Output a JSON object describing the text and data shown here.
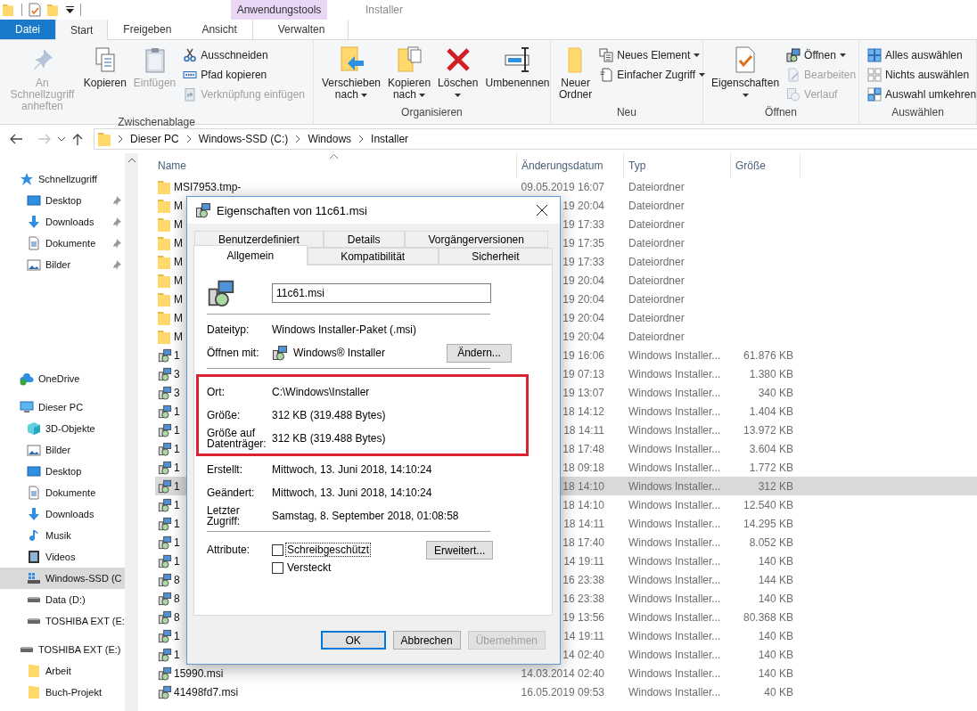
{
  "title_bar": {
    "context_label": "Anwendungstools",
    "window_title": "Installer"
  },
  "ribbon_tabs": [
    {
      "label": "Datei",
      "kind": "file",
      "selected": false
    },
    {
      "label": "Start",
      "kind": "tab",
      "selected": true
    },
    {
      "label": "Freigeben",
      "kind": "tab",
      "selected": false
    },
    {
      "label": "Ansicht",
      "kind": "tab",
      "selected": false
    },
    {
      "label": "Verwalten",
      "kind": "contextual",
      "selected": false
    }
  ],
  "ribbon_groups": [
    {
      "label": "Zwischenablage",
      "items": [
        {
          "label": "An Schnellzugriff anheften",
          "kind": "large",
          "disabled": true,
          "dropdown": false
        },
        {
          "label": "Kopieren",
          "kind": "large",
          "disabled": false,
          "dropdown": false
        },
        {
          "label": "Einfügen",
          "kind": "large",
          "disabled": true,
          "dropdown": false
        },
        {
          "label": "Ausschneiden",
          "kind": "small",
          "disabled": false,
          "dropdown": false
        },
        {
          "label": "Pfad kopieren",
          "kind": "small",
          "disabled": false,
          "dropdown": false
        },
        {
          "label": "Verknüpfung einfügen",
          "kind": "small",
          "disabled": true,
          "dropdown": false
        }
      ]
    },
    {
      "label": "Organisieren",
      "items": [
        {
          "label": "Verschieben nach",
          "kind": "large",
          "disabled": false,
          "dropdown": true
        },
        {
          "label": "Kopieren nach",
          "kind": "large",
          "disabled": false,
          "dropdown": true
        },
        {
          "label": "Löschen",
          "kind": "large",
          "disabled": false,
          "dropdown": true
        },
        {
          "label": "Umbenennen",
          "kind": "large",
          "disabled": false,
          "dropdown": false
        }
      ]
    },
    {
      "label": "Neu",
      "items": [
        {
          "label": "Neuer Ordner",
          "kind": "large",
          "disabled": false,
          "dropdown": false
        },
        {
          "label": "Neues Element",
          "kind": "small",
          "disabled": false,
          "dropdown": true
        },
        {
          "label": "Einfacher Zugriff",
          "kind": "small",
          "disabled": false,
          "dropdown": true
        }
      ]
    },
    {
      "label": "Öffnen",
      "items": [
        {
          "label": "Eigenschaften",
          "kind": "large",
          "disabled": false,
          "dropdown": true
        },
        {
          "label": "Öffnen",
          "kind": "small",
          "disabled": false,
          "dropdown": true
        },
        {
          "label": "Bearbeiten",
          "kind": "small",
          "disabled": true,
          "dropdown": false
        },
        {
          "label": "Verlauf",
          "kind": "small",
          "disabled": true,
          "dropdown": false
        }
      ]
    },
    {
      "label": "Auswählen",
      "items": [
        {
          "label": "Alles auswählen",
          "kind": "small",
          "disabled": false,
          "dropdown": false
        },
        {
          "label": "Nichts auswählen",
          "kind": "small",
          "disabled": false,
          "dropdown": false
        },
        {
          "label": "Auswahl umkehren",
          "kind": "small",
          "disabled": false,
          "dropdown": false
        }
      ]
    }
  ],
  "address_bar": {
    "forward_disabled": true,
    "path": [
      "Dieser PC",
      "Windows-SSD (C:)",
      "Windows",
      "Installer"
    ]
  },
  "sidebar": {
    "sections": [
      {
        "label": "Schnellzugriff",
        "kind": "quick",
        "selected": false,
        "children": [
          {
            "label": "Desktop",
            "kind": "desktop",
            "pinned": true,
            "selected": false
          },
          {
            "label": "Downloads",
            "kind": "downloads",
            "pinned": true,
            "selected": false
          },
          {
            "label": "Dokumente",
            "kind": "documents",
            "pinned": true,
            "selected": false
          },
          {
            "label": "Bilder",
            "kind": "pictures",
            "pinned": true,
            "selected": false
          }
        ]
      },
      {
        "label": "OneDrive",
        "kind": "cloud",
        "selected": false
      },
      {
        "label": "Dieser PC",
        "kind": "pc",
        "selected": false,
        "children": [
          {
            "label": "3D-Objekte",
            "kind": "cube",
            "selected": false
          },
          {
            "label": "Bilder",
            "kind": "pictures",
            "selected": false
          },
          {
            "label": "Desktop",
            "kind": "desktop",
            "selected": false
          },
          {
            "label": "Dokumente",
            "kind": "documents",
            "selected": false
          },
          {
            "label": "Downloads",
            "kind": "downloads",
            "selected": false
          },
          {
            "label": "Musik",
            "kind": "music",
            "selected": false
          },
          {
            "label": "Videos",
            "kind": "videos",
            "selected": false
          },
          {
            "label": "Windows-SSD (C",
            "kind": "system-drive",
            "selected": true
          },
          {
            "label": "Data (D:)",
            "kind": "drive",
            "selected": false
          },
          {
            "label": "TOSHIBA EXT (E:",
            "kind": "drive",
            "selected": false
          }
        ]
      },
      {
        "label": "TOSHIBA EXT (E:)",
        "kind": "drive",
        "selected": false,
        "children": [
          {
            "label": "Arbeit",
            "kind": "folder",
            "selected": false
          },
          {
            "label": "Buch-Projekt",
            "kind": "folder",
            "selected": false
          }
        ]
      }
    ]
  },
  "file_list": {
    "columns": [
      "Name",
      "Änderungsdatum",
      "Typ",
      "Größe"
    ],
    "rows": [
      {
        "name": "MSI7953.tmp-",
        "date": "09.05.2019 16:07",
        "type": "Dateiordner",
        "size": "",
        "kind": "folder",
        "selected": false
      },
      {
        "name": "M",
        "date": "19 20:04",
        "type": "Dateiordner",
        "size": "",
        "kind": "folder",
        "selected": false
      },
      {
        "name": "M",
        "date": "19 17:33",
        "type": "Dateiordner",
        "size": "",
        "kind": "folder",
        "selected": false
      },
      {
        "name": "M",
        "date": "19 17:35",
        "type": "Dateiordner",
        "size": "",
        "kind": "folder",
        "selected": false
      },
      {
        "name": "M",
        "date": "19 17:33",
        "type": "Dateiordner",
        "size": "",
        "kind": "folder",
        "selected": false
      },
      {
        "name": "M",
        "date": "19 20:04",
        "type": "Dateiordner",
        "size": "",
        "kind": "folder",
        "selected": false
      },
      {
        "name": "M",
        "date": "19 20:04",
        "type": "Dateiordner",
        "size": "",
        "kind": "folder",
        "selected": false
      },
      {
        "name": "M",
        "date": "19 20:04",
        "type": "Dateiordner",
        "size": "",
        "kind": "folder",
        "selected": false
      },
      {
        "name": "M",
        "date": "19 20:04",
        "type": "Dateiordner",
        "size": "",
        "kind": "folder",
        "selected": false
      },
      {
        "name": "1",
        "date": "19 16:06",
        "type": "Windows Installer...",
        "size": "61.876 KB",
        "kind": "installer",
        "selected": false
      },
      {
        "name": "3",
        "date": "19 07:13",
        "type": "Windows Installer...",
        "size": "1.380 KB",
        "kind": "installer",
        "selected": false
      },
      {
        "name": "3",
        "date": "19 13:07",
        "type": "Windows Installer...",
        "size": "340 KB",
        "kind": "installer",
        "selected": false
      },
      {
        "name": "1",
        "date": "18 14:12",
        "type": "Windows Installer...",
        "size": "1.404 KB",
        "kind": "installer",
        "selected": false
      },
      {
        "name": "1",
        "date": "18 14:11",
        "type": "Windows Installer...",
        "size": "13.972 KB",
        "kind": "installer",
        "selected": false
      },
      {
        "name": "1",
        "date": "18 17:48",
        "type": "Windows Installer...",
        "size": "3.604 KB",
        "kind": "installer",
        "selected": false
      },
      {
        "name": "1",
        "date": "18 09:18",
        "type": "Windows Installer...",
        "size": "1.772 KB",
        "kind": "installer",
        "selected": false
      },
      {
        "name": "1",
        "date": "18 14:10",
        "type": "Windows Installer...",
        "size": "312 KB",
        "kind": "installer",
        "selected": true
      },
      {
        "name": "1",
        "date": "18 14:10",
        "type": "Windows Installer...",
        "size": "12.540 KB",
        "kind": "installer",
        "selected": false
      },
      {
        "name": "1",
        "date": "18 14:11",
        "type": "Windows Installer...",
        "size": "14.295 KB",
        "kind": "installer",
        "selected": false
      },
      {
        "name": "1",
        "date": "18 17:40",
        "type": "Windows Installer...",
        "size": "8.052 KB",
        "kind": "installer",
        "selected": false
      },
      {
        "name": "1",
        "date": "14 19:11",
        "type": "Windows Installer...",
        "size": "140 KB",
        "kind": "installer",
        "selected": false
      },
      {
        "name": "8",
        "date": "16 23:38",
        "type": "Windows Installer...",
        "size": "144 KB",
        "kind": "installer",
        "selected": false
      },
      {
        "name": "8",
        "date": "16 23:38",
        "type": "Windows Installer...",
        "size": "140 KB",
        "kind": "installer",
        "selected": false
      },
      {
        "name": "8",
        "date": "19 13:56",
        "type": "Windows Installer...",
        "size": "80.368 KB",
        "kind": "installer",
        "selected": false
      },
      {
        "name": "1",
        "date": "14 19:11",
        "type": "Windows Installer...",
        "size": "140 KB",
        "kind": "installer",
        "selected": false
      },
      {
        "name": "1",
        "date": "14 02:40",
        "type": "Windows Installer...",
        "size": "140 KB",
        "kind": "installer",
        "selected": false
      },
      {
        "name": "15990.msi",
        "date": "14.03.2014 02:40",
        "type": "Windows Installer...",
        "size": "140 KB",
        "kind": "installer",
        "selected": false
      },
      {
        "name": "41498fd7.msi",
        "date": "16.05.2019 09:53",
        "type": "Windows Installer...",
        "size": "40 KB",
        "kind": "installer",
        "selected": false
      }
    ]
  },
  "dialog": {
    "title": "Eigenschaften von 11c61.msi",
    "tab_rows": [
      [
        {
          "label": "Benutzerdefiniert",
          "selected": false
        },
        {
          "label": "Details",
          "selected": false
        },
        {
          "label": "Vorgängerversionen",
          "selected": false
        }
      ],
      [
        {
          "label": "Allgemein",
          "selected": true
        },
        {
          "label": "Kompatibilität",
          "selected": false
        },
        {
          "label": "Sicherheit",
          "selected": false
        }
      ]
    ],
    "file_name": "11c61.msi",
    "file_type": {
      "label": "Dateityp:",
      "value": "Windows Installer-Paket (.msi)"
    },
    "opens_with": {
      "label": "Öffnen mit:",
      "value": "Windows® Installer",
      "button": "Ändern..."
    },
    "highlighted": [
      {
        "label": "Ort:",
        "value": "C:\\Windows\\Installer"
      },
      {
        "label": "Größe:",
        "value": "312 KB (319.488 Bytes)"
      },
      {
        "label": "Größe auf Datenträger:",
        "value": "312 KB (319.488 Bytes)"
      }
    ],
    "dates": [
      {
        "label": "Erstellt:",
        "value": "Mittwoch, 13. Juni 2018, 14:10:24"
      },
      {
        "label": "Geändert:",
        "value": "Mittwoch, 13. Juni 2018, 14:10:24"
      },
      {
        "label": "Letzter Zugriff:",
        "value": "Samstag, 8. September 2018, 01:08:58"
      }
    ],
    "attributes": {
      "label": "Attribute:",
      "items": [
        {
          "label": "Schreibgeschützt",
          "checked": false,
          "focused": true
        },
        {
          "label": "Versteckt",
          "checked": false,
          "focused": false
        }
      ],
      "button": "Erweitert..."
    },
    "buttons": [
      {
        "label": "OK",
        "default": true,
        "disabled": false
      },
      {
        "label": "Abbrechen",
        "default": false,
        "disabled": false
      },
      {
        "label": "Übernehmen",
        "default": false,
        "disabled": true
      }
    ]
  }
}
